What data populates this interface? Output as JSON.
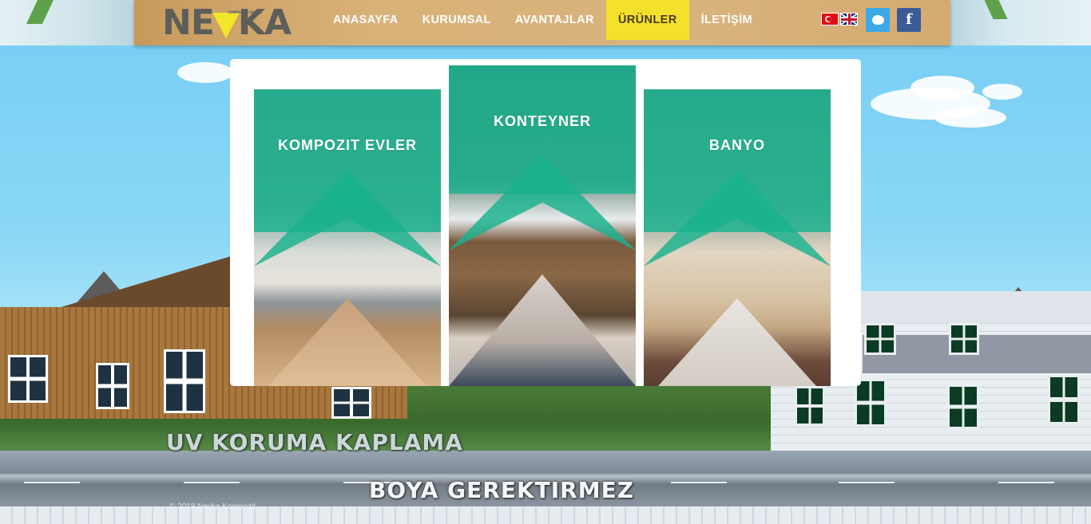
{
  "header": {
    "logo_text_1": "NE",
    "logo_text_2": "KA",
    "logo_subtitle": "COMPOSITE HOUSE",
    "nav": [
      {
        "label": "ANASAYFA",
        "active": false
      },
      {
        "label": "KURUMSAL",
        "active": false
      },
      {
        "label": "AVANTAJLAR",
        "active": false
      },
      {
        "label": "ÜRÜNLER",
        "active": true
      },
      {
        "label": "İLETİŞİM",
        "active": false
      }
    ],
    "languages": [
      "tr-flag-icon",
      "en-flag-icon"
    ],
    "social": {
      "twitter_icon": "twitter-icon",
      "facebook_label": "f"
    }
  },
  "products": [
    {
      "title": "KOMPOZIT EVLER"
    },
    {
      "title": "KONTEYNER"
    },
    {
      "title": "BANYO"
    }
  ],
  "banner": {
    "slogan_1": "UV KORUMA KAPLAMA",
    "slogan_2": "BOYA GEREKTIRMEZ"
  },
  "footer": {
    "copyright": "© 2018 Nevka Kompozit"
  },
  "colors": {
    "accent_yellow": "#f4e12c",
    "product_teal": "#18b28e",
    "header_wood": "#d9b27a"
  }
}
